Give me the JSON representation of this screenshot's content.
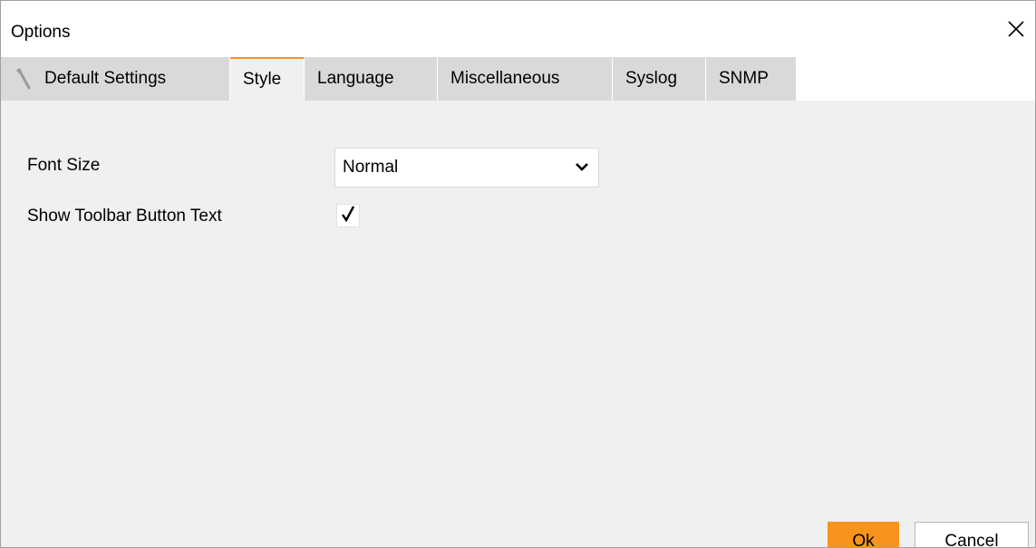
{
  "window": {
    "title": "Options",
    "close_icon": "close-icon"
  },
  "tabs": [
    {
      "label": "Default Settings",
      "icon": "wrench-icon",
      "active": false
    },
    {
      "label": "Style",
      "active": true
    },
    {
      "label": "Language",
      "active": false
    },
    {
      "label": "Miscellaneous",
      "active": false
    },
    {
      "label": "Syslog",
      "active": false
    },
    {
      "label": "SNMP",
      "active": false
    }
  ],
  "style_tab": {
    "font_size_label": "Font Size",
    "font_size_value": "Normal",
    "toolbar_text_label": "Show Toolbar Button Text",
    "toolbar_text_checked": true
  },
  "buttons": {
    "ok_mnemonic": "O",
    "ok_rest": "k",
    "cancel_before": "C",
    "cancel_mnemonic": "a",
    "cancel_after": "ncel"
  },
  "colors": {
    "accent": "#f7941d",
    "tab_inactive": "#d9d9d9",
    "panel": "#f0f0f0"
  }
}
